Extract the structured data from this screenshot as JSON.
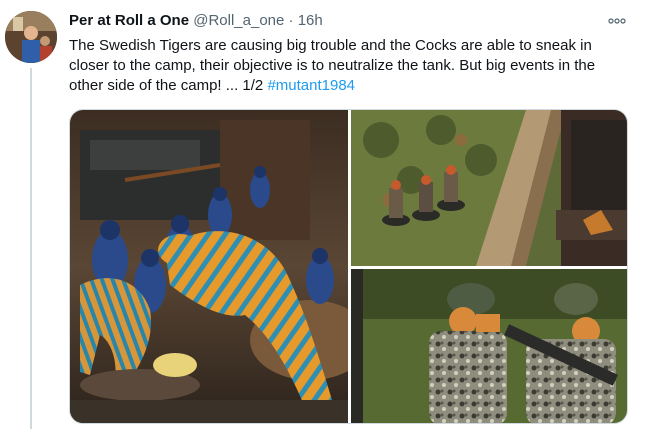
{
  "tweet": {
    "author_name": "Per at Roll a One",
    "handle": "@Roll_a_one",
    "separator": "·",
    "time": "16h",
    "text_main": "The Swedish Tigers are causing big trouble and the Cocks are able to sneak in closer to the camp, their objective is to neutralize the tank. But big events in the other side of the camp! ... 1/2  ",
    "hashtag": "#mutant1984",
    "icons": {
      "more": "more-icon",
      "avatar": "avatar"
    }
  },
  "colors": {
    "link": "#1d9bf0",
    "text": "#0f1419",
    "secondary": "#536471"
  }
}
